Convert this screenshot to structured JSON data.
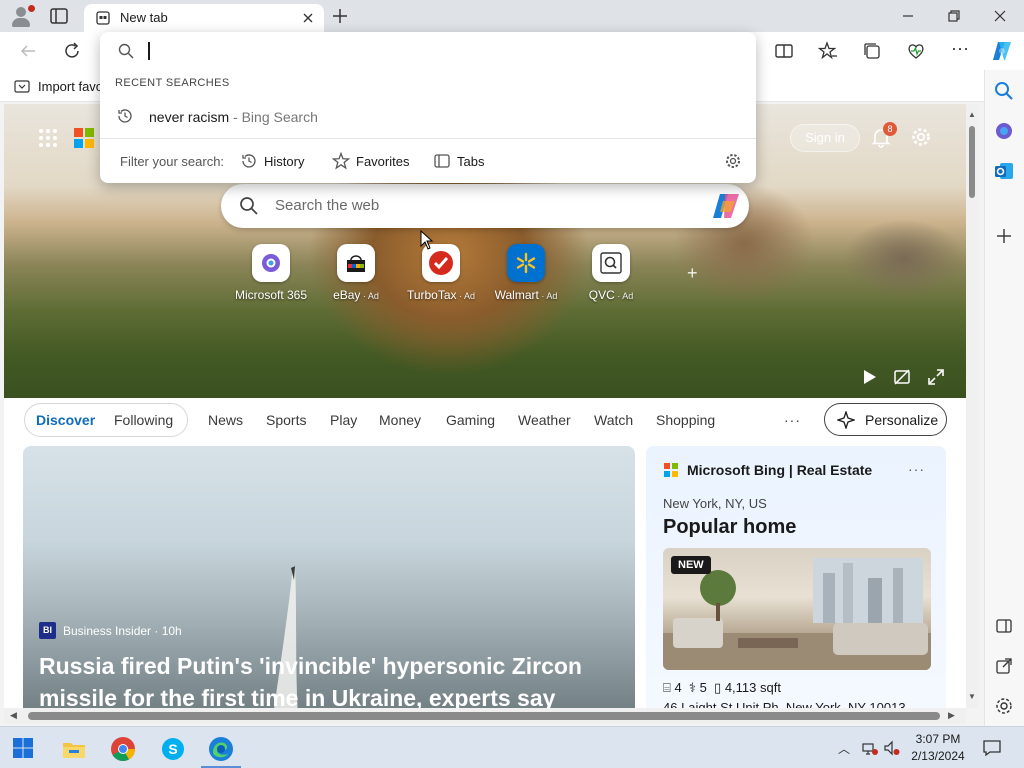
{
  "browser": {
    "tab_title": "New tab",
    "favorites_bar_label": "Import favo"
  },
  "omnibox": {
    "input_value": "",
    "section_header": "RECENT SEARCHES",
    "suggestion_text": "never racism",
    "suggestion_source": " - Bing Search",
    "filter_label": "Filter your search:",
    "filters": [
      "History",
      "Favorites",
      "Tabs"
    ]
  },
  "hero": {
    "sign_in": "Sign in",
    "notification_count": "8",
    "search_placeholder": "Search the web",
    "quick_links": [
      {
        "label": "Microsoft 365",
        "ad": ""
      },
      {
        "label": "eBay",
        "ad": " · Ad"
      },
      {
        "label": "TurboTax",
        "ad": " · Ad"
      },
      {
        "label": "Walmart",
        "ad": " · Ad"
      },
      {
        "label": "QVC",
        "ad": " · Ad"
      }
    ]
  },
  "feed_nav": {
    "items": [
      "Discover",
      "Following",
      "News",
      "Sports",
      "Play",
      "Money",
      "Gaming",
      "Weather",
      "Watch",
      "Shopping"
    ],
    "more": "···",
    "personalize": "Personalize"
  },
  "main_card": {
    "source_logo": "BI",
    "source": "Business Insider · 10h",
    "headline": "Russia fired Putin's 'invincible' hypersonic Zircon missile for the first time in Ukraine, experts say"
  },
  "side_card": {
    "source": "Microsoft Bing | Real Estate",
    "more": "···",
    "location": "New York, NY, US",
    "title": "Popular home",
    "badge": "NEW",
    "beds": "4",
    "baths": "5",
    "area": "4,113 sqft",
    "address": "46 Laight St Unit Ph, New York, NY 10013"
  },
  "taskbar": {
    "time": "3:07 PM",
    "date": "2/13/2024"
  },
  "colors": {
    "accent": "#0f6cbd",
    "badge": "#e05a3a",
    "edge_blue": "#1a7fd8"
  }
}
